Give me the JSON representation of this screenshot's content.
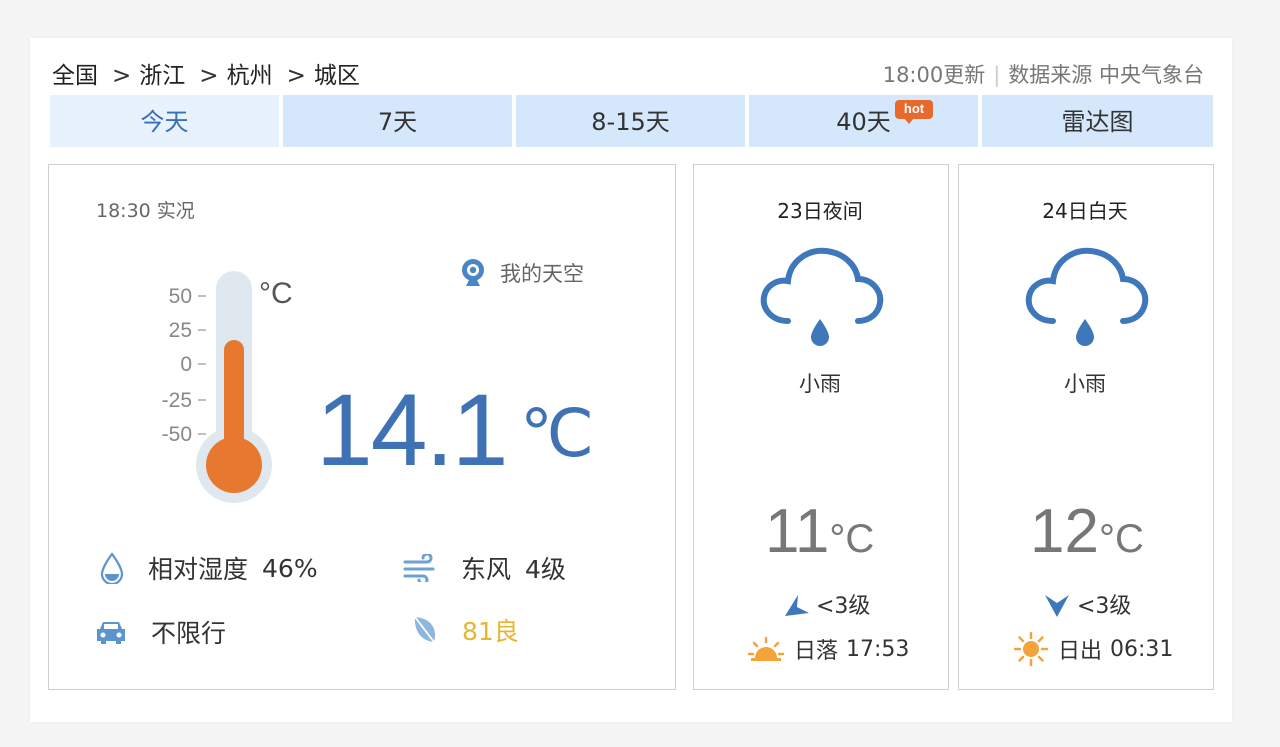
{
  "breadcrumb": [
    "全国",
    "浙江",
    "杭州",
    "城区"
  ],
  "breadcrumb_sep": ">",
  "update": {
    "time": "18:00更新",
    "source_label": "数据来源 中央气象台"
  },
  "tabs": [
    {
      "label": "今天",
      "active": true
    },
    {
      "label": "7天",
      "active": false
    },
    {
      "label": "8-15天",
      "active": false
    },
    {
      "label": "40天",
      "active": false,
      "badge": "hot"
    },
    {
      "label": "雷达图",
      "active": false
    }
  ],
  "current": {
    "obs_time": "18:30 实况",
    "my_sky": "我的天空",
    "temperature": "14.1",
    "unit": "℃",
    "thermometer": {
      "unit": "°C",
      "scale": [
        "50",
        "25",
        "0",
        "-25",
        "-50"
      ]
    },
    "humidity_label": "相对湿度",
    "humidity_value": "46%",
    "wind_dir": "东风",
    "wind_level": "4级",
    "traffic": "不限行",
    "aqi": "81良"
  },
  "forecast": [
    {
      "title": "23日夜间",
      "condition": "小雨",
      "temp": "11",
      "unit": "°C",
      "wind": "<3级",
      "sun_label": "日落",
      "sun_time": "17:53"
    },
    {
      "title": "24日白天",
      "condition": "小雨",
      "temp": "12",
      "unit": "°C",
      "wind": "<3级",
      "sun_label": "日出",
      "sun_time": "06:31"
    }
  ],
  "colors": {
    "accent": "#3e72b4",
    "tab_bg": "#d5e7fa",
    "tab_active_bg": "#e7f2fd",
    "thermo_fill": "#e6782f",
    "aqi": "#e8b531",
    "sun": "#f4a33a"
  }
}
